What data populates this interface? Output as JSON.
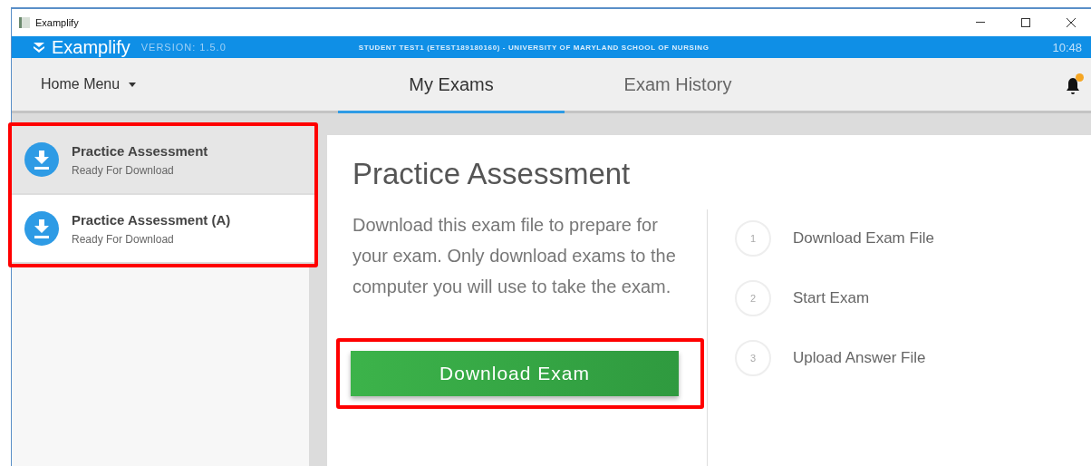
{
  "window": {
    "title": "Examplify"
  },
  "header": {
    "brand": "Examplify",
    "version": "VERSION: 1.5.0",
    "student": "STUDENT TEST1 (ETEST189180160) - UNIVERSITY OF MARYLAND SCHOOL OF NURSING",
    "time": "10:48"
  },
  "nav": {
    "home_menu": "Home Menu",
    "tabs": [
      {
        "label": "My Exams",
        "selected": true
      },
      {
        "label": "Exam History",
        "selected": false
      }
    ],
    "notification": true
  },
  "exams": [
    {
      "title": "Practice Assessment",
      "status": "Ready For Download",
      "selected": true
    },
    {
      "title": "Practice Assessment (A)",
      "status": "Ready For Download",
      "selected": false
    }
  ],
  "detail": {
    "title": "Practice Assessment",
    "description": "Download this exam file to prepare for your exam. Only download exams to the computer you will use to take the exam.",
    "button": "Download Exam",
    "steps": [
      {
        "number": "1",
        "label": "Download Exam File"
      },
      {
        "number": "2",
        "label": "Start Exam"
      },
      {
        "number": "3",
        "label": "Upload Answer File"
      }
    ]
  }
}
